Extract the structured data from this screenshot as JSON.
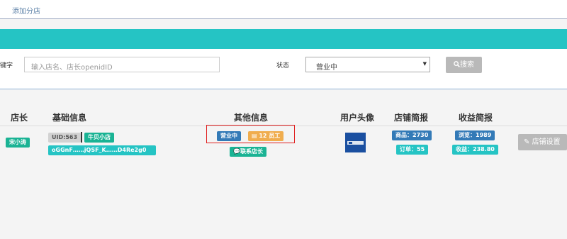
{
  "topbar": {
    "tab_label": "添加分店"
  },
  "filter": {
    "keyword_label": "键字",
    "keyword_placeholder": "输入店名、店长openidID",
    "status_label": "状态",
    "status_value": "营业中",
    "search_label": "搜索"
  },
  "table": {
    "headers": [
      "店长",
      "基础信息",
      "其他信息",
      "用户头像",
      "店铺简报",
      "收益简报"
    ],
    "row": {
      "manager": "宋小涛",
      "uid": "UID:563",
      "shop_name": "牛贝小店",
      "openid": "oGGnF……jQSF_K……D4Re2g0",
      "status": "营业中",
      "staff": "12 员工",
      "contact": "联系店长",
      "products": "商品：2730",
      "orders": "订单：55",
      "views": "浏览：1989",
      "income": "收益：238.80",
      "settings_label": "店铺设置"
    }
  },
  "colors": {
    "teal": "#25c4c4",
    "blue": "#337ab7",
    "orange": "#f0ad4e",
    "green": "#1ab394",
    "grey": "#b9b9b9"
  }
}
